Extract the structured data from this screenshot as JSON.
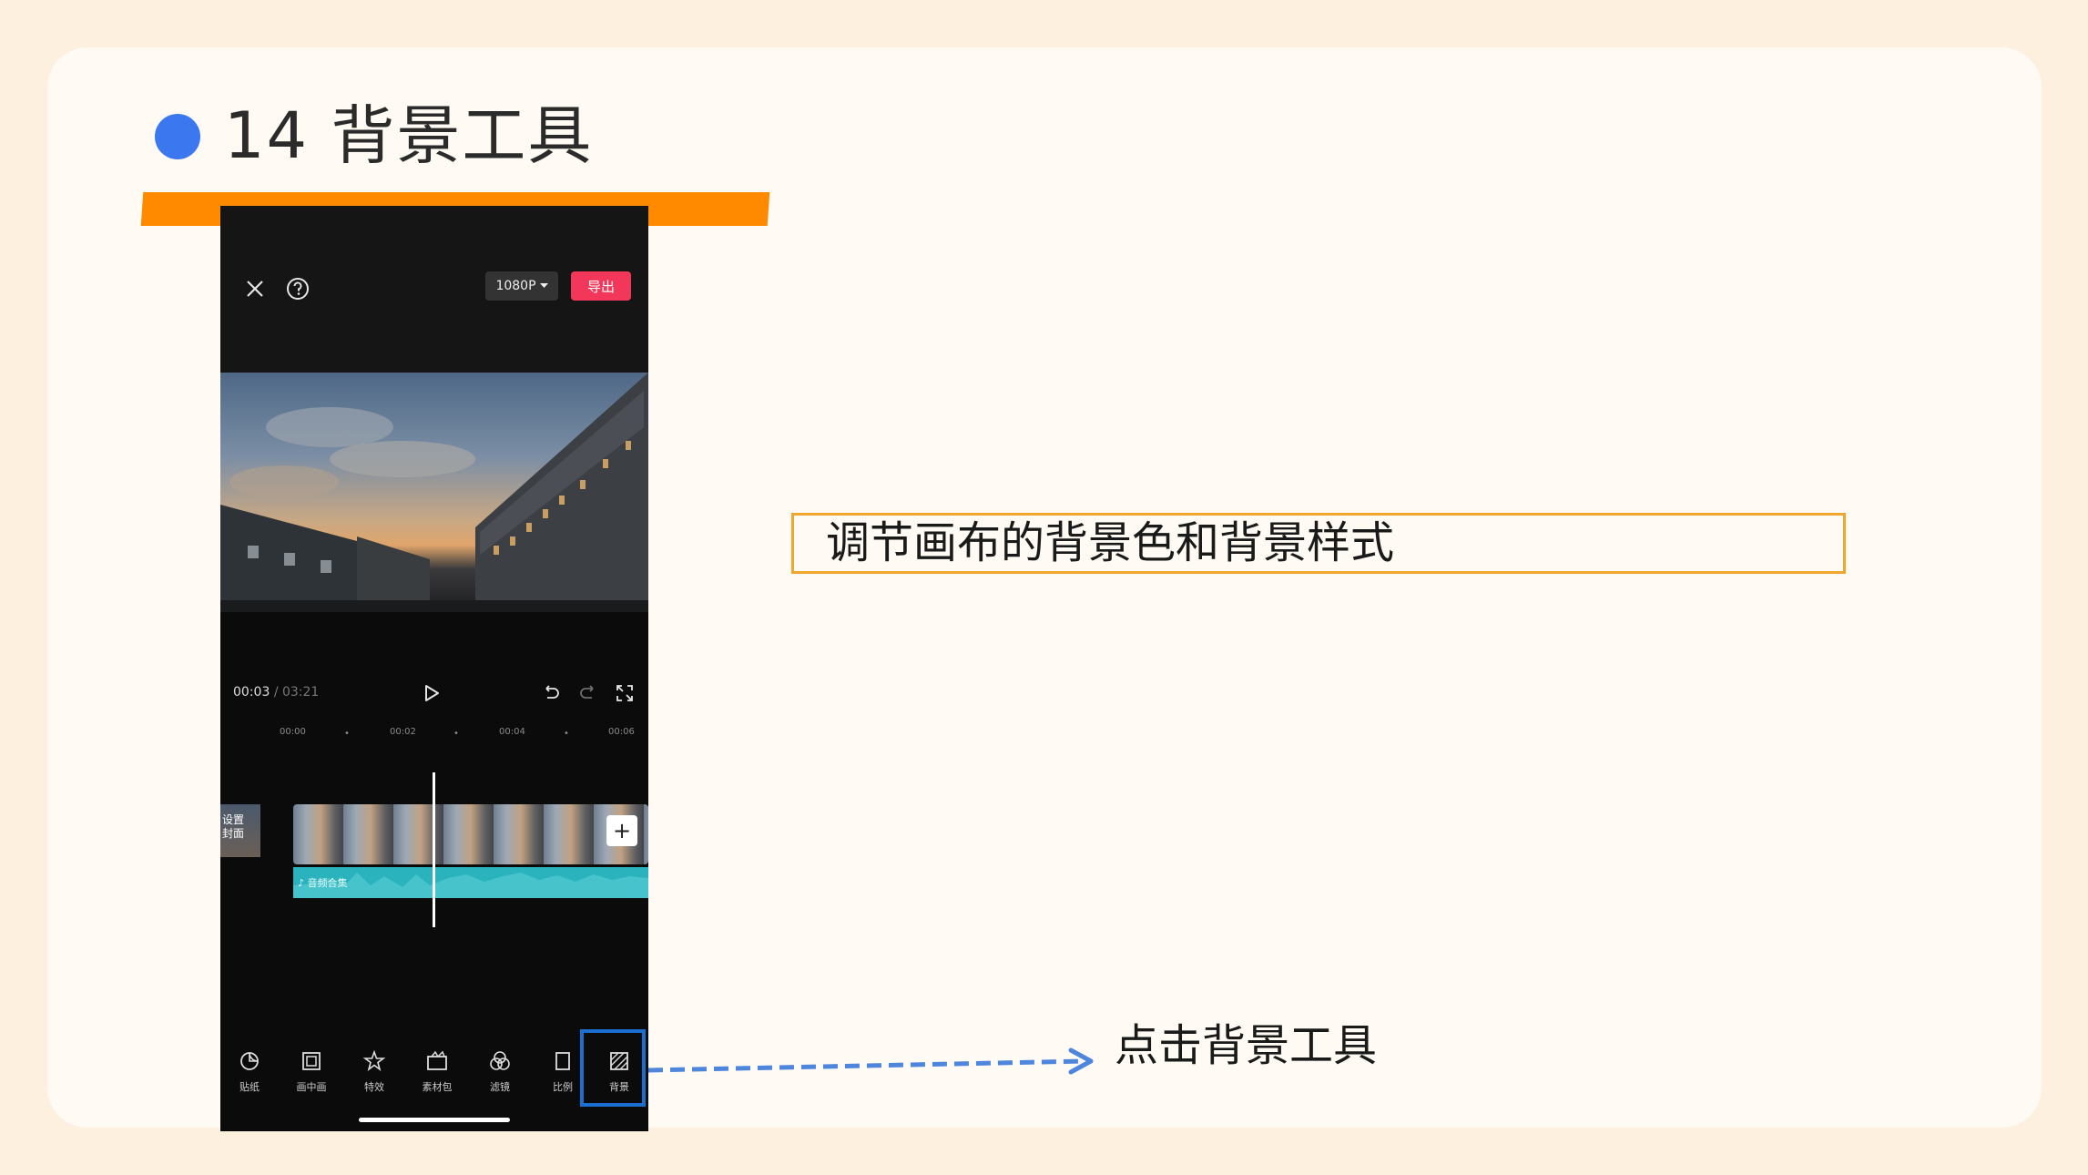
{
  "slide": {
    "title": "14 背景工具",
    "callout": "调节画布的背景色和背景样式",
    "step_hint": "点击背景工具",
    "accent_colors": {
      "dot": "#3b78f0",
      "bar": "#ff8a00",
      "callout_border": "#f0a52d",
      "highlight": "#1a6fd1"
    }
  },
  "editor": {
    "header": {
      "close_icon": "close-icon",
      "help_icon": "help-icon",
      "resolution": "1080P",
      "export": "导出"
    },
    "playback": {
      "current": "00:03",
      "separator": "/",
      "total": "03:21"
    },
    "ruler": {
      "ticks": [
        "00:00",
        "00:02",
        "00:04",
        "00:06"
      ]
    },
    "timeline": {
      "cover_line1": "设置",
      "cover_line2": "封面",
      "add_clip": "+",
      "audio_label": "♪ 音频合集"
    },
    "toolbar": [
      {
        "icon": "sticker-icon",
        "label": "贴纸"
      },
      {
        "icon": "picture-in-picture-icon",
        "label": "画中画"
      },
      {
        "icon": "effects-icon",
        "label": "特效"
      },
      {
        "icon": "material-pack-icon",
        "label": "素材包"
      },
      {
        "icon": "filter-icon",
        "label": "滤镜"
      },
      {
        "icon": "ratio-icon",
        "label": "比例"
      },
      {
        "icon": "background-icon",
        "label": "背景"
      }
    ]
  }
}
